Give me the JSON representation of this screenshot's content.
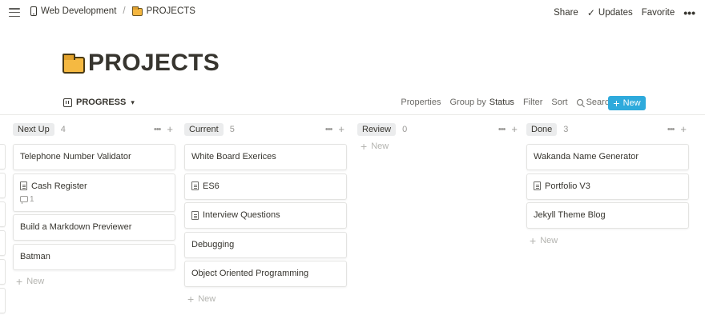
{
  "breadcrumb": {
    "workspace": "Web Development",
    "separator": "/",
    "page": "PROJECTS"
  },
  "top_actions": {
    "share": "Share",
    "updates": "Updates",
    "favorite": "Favorite",
    "more": "•••"
  },
  "page": {
    "title": "PROJECTS",
    "icon": "folder-icon"
  },
  "view": {
    "name": "PROGRESS",
    "properties": "Properties",
    "group_by": "Group by",
    "group_by_value": "Status",
    "filter": "Filter",
    "sort": "Sort",
    "search": "Search",
    "more": "•••",
    "new_button": "New",
    "accent_color": "#2eaadc"
  },
  "board": {
    "more_glyph": "•••",
    "add_glyph": "+",
    "new_label": "New",
    "columns": [
      {
        "label": "Next Up",
        "count": "4",
        "cards": [
          {
            "title": "Telephone Number Validator"
          },
          {
            "title": "Cash Register",
            "doc": true,
            "comments": "1"
          },
          {
            "title": "Build a Markdown Previewer"
          },
          {
            "title": "Batman"
          }
        ]
      },
      {
        "label": "Current",
        "count": "5",
        "cards": [
          {
            "title": "White Board Exerices"
          },
          {
            "title": "ES6",
            "doc": true
          },
          {
            "title": "Interview Questions",
            "doc": true
          },
          {
            "title": "Debugging"
          },
          {
            "title": "Object Oriented Programming"
          }
        ]
      },
      {
        "label": "Review",
        "count": "0",
        "cards": []
      },
      {
        "label": "Done",
        "count": "3",
        "cards": [
          {
            "title": "Wakanda Name Generator"
          },
          {
            "title": "Portfolio V3",
            "doc": true
          },
          {
            "title": "Jekyll Theme Blog"
          }
        ]
      }
    ]
  }
}
